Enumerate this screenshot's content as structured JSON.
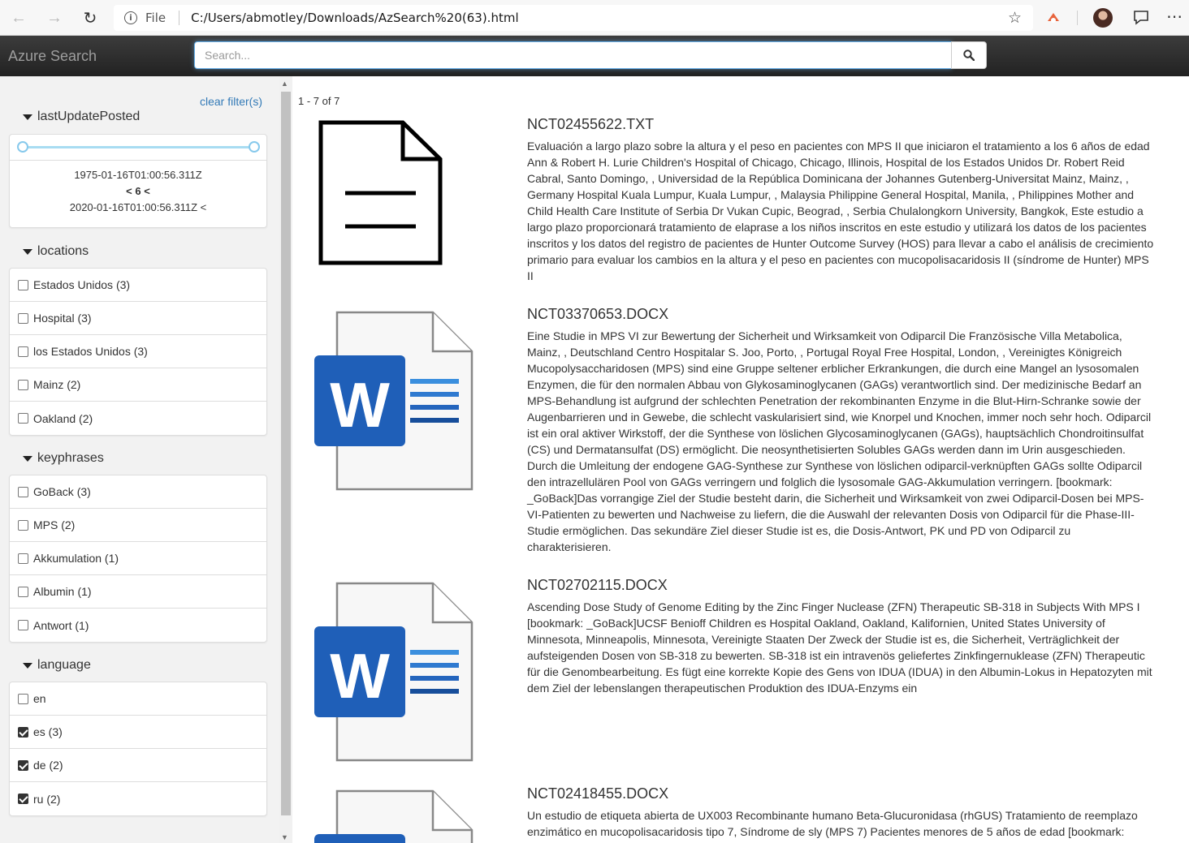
{
  "browser": {
    "file_label": "File",
    "url": "C:/Users/abmotley/Downloads/AzSearch%20(63).html"
  },
  "header": {
    "brand": "Azure Search",
    "search_placeholder": "Search..."
  },
  "sidebar": {
    "clear_label": "clear filter(s)",
    "date_facet": {
      "title": "lastUpdatePosted",
      "range_start": "1975-01-16T01:00:56.311Z",
      "range_middle": "< 6 <",
      "range_end": "2020-01-16T01:00:56.311Z <"
    },
    "locations": {
      "title": "locations",
      "items": [
        {
          "label": "Estados Unidos (3)",
          "checked": false
        },
        {
          "label": "Hospital (3)",
          "checked": false
        },
        {
          "label": "los Estados Unidos (3)",
          "checked": false
        },
        {
          "label": "Mainz (2)",
          "checked": false
        },
        {
          "label": "Oakland (2)",
          "checked": false
        }
      ]
    },
    "keyphrases": {
      "title": "keyphrases",
      "items": [
        {
          "label": "GoBack (3)",
          "checked": false
        },
        {
          "label": "MPS (2)",
          "checked": false
        },
        {
          "label": "Akkumulation (1)",
          "checked": false
        },
        {
          "label": "Albumin (1)",
          "checked": false
        },
        {
          "label": "Antwort (1)",
          "checked": false
        }
      ]
    },
    "language": {
      "title": "language",
      "items": [
        {
          "label": "en",
          "checked": false
        },
        {
          "label": "es (3)",
          "checked": true
        },
        {
          "label": "de (2)",
          "checked": true
        },
        {
          "label": "ru (2)",
          "checked": true
        }
      ]
    }
  },
  "results": {
    "count_label": "1 - 7 of 7",
    "items": [
      {
        "title": "NCT02455622.TXT",
        "icon": "text-file-icon",
        "description": "Evaluación a largo plazo sobre la altura y el peso en pacientes con MPS II que iniciaron el tratamiento a los 6 años de edad Ann & Robert H. Lurie Children's Hospital of Chicago, Chicago, Illinois, Hospital de los Estados Unidos Dr. Robert Reid Cabral, Santo Domingo, , Universidad de la República Dominicana der Johannes Gutenberg-Universitat Mainz, Mainz, , Germany Hospital Kuala Lumpur, Kuala Lumpur, , Malaysia Philippine General Hospital, Manila, , Philippines Mother and Child Health Care Institute of Serbia Dr Vukan Cupic, Beograd, , Serbia Chulalongkorn University, Bangkok, Este estudio a largo plazo proporcionará tratamiento de elaprase a los niños inscritos en este estudio y utilizará los datos de los pacientes inscritos y los datos del registro de pacientes de Hunter Outcome Survey (HOS) para llevar a cabo el análisis de crecimiento primario para evaluar los cambios en la altura y el peso en pacientes con mucopolisacaridosis II (síndrome de Hunter) MPS II"
      },
      {
        "title": "NCT03370653.DOCX",
        "icon": "word-document-icon",
        "description": "Eine Studie in MPS VI zur Bewertung der Sicherheit und Wirksamkeit von Odiparcil Die Französische Villa Metabolica, Mainz, , Deutschland Centro Hospitalar S. Joo, Porto, , Portugal Royal Free Hospital, London, , Vereinigtes Königreich Mucopolysaccharidosen (MPS) sind eine Gruppe seltener erblicher Erkrankungen, die durch eine Mangel an lysosomalen Enzymen, die für den normalen Abbau von Glykosaminoglycanen (GAGs) verantwortlich sind. Der medizinische Bedarf an MPS-Behandlung ist aufgrund der schlechten Penetration der rekombinanten Enzyme in die Blut-Hirn-Schranke sowie der Augenbarrieren und in Gewebe, die schlecht vaskularisiert sind, wie Knorpel und Knochen, immer noch sehr hoch. Odiparcil ist ein oral aktiver Wirkstoff, der die Synthese von löslichen Glycosaminoglycanen (GAGs), hauptsächlich Chondroitinsulfat (CS) und Dermatansulfat (DS) ermöglicht. Die neosynthetisierten Solubles GAGs werden dann im Urin ausgeschieden. Durch die Umleitung der endogene GAG-Synthese zur Synthese von löslichen odiparcil-verknüpften GAGs sollte Odiparcil den intrazellulären Pool von GAGs verringern und folglich die lysosomale GAG-Akkumulation verringern. [bookmark: _GoBack]Das vorrangige Ziel der Studie besteht darin, die Sicherheit und Wirksamkeit von zwei Odiparcil-Dosen bei MPS-VI-Patienten zu bewerten und Nachweise zu liefern, die die Auswahl der relevanten Dosis von Odiparcil für die Phase-III-Studie ermöglichen. Das sekundäre Ziel dieser Studie ist es, die Dosis-Antwort, PK und PD von Odiparcil zu charakterisieren."
      },
      {
        "title": "NCT02702115.DOCX",
        "icon": "word-document-icon",
        "description": "Ascending Dose Study of Genome Editing by the Zinc Finger Nuclease (ZFN) Therapeutic SB-318 in Subjects With MPS I [bookmark: _GoBack]UCSF Benioff Children es Hospital Oakland, Oakland, Kalifornien, United States University of Minnesota, Minneapolis, Minnesota, Vereinigte Staaten Der Zweck der Studie ist es, die Sicherheit, Verträglichkeit der aufsteigenden Dosen von SB-318 zu bewerten. SB-318 ist ein intravenös geliefertes Zinkfingernuklease (ZFN) Therapeutic für die Genombearbeitung. Es fügt eine korrekte Kopie des Gens von IDUA (IDUA) in den Albumin-Lokus in Hepatozyten mit dem Ziel der lebenslangen therapeutischen Produktion des IDUA-Enzyms ein"
      },
      {
        "title": "NCT02418455.DOCX",
        "icon": "word-document-icon",
        "description": "Un estudio de etiqueta abierta de UX003 Recombinante humano Beta-Glucuronidasa (rhGUS) Tratamiento de reemplazo enzimático en mucopolisacaridosis tipo 7, Síndrome de sly (MPS 7) Pacientes menores de 5 años de edad [bookmark:"
      }
    ]
  },
  "colors": {
    "header_dark": "#222222",
    "link_blue": "#337ab7",
    "word_blue": "#1f5fb8",
    "sidebar_bg": "#f2f2f2"
  }
}
